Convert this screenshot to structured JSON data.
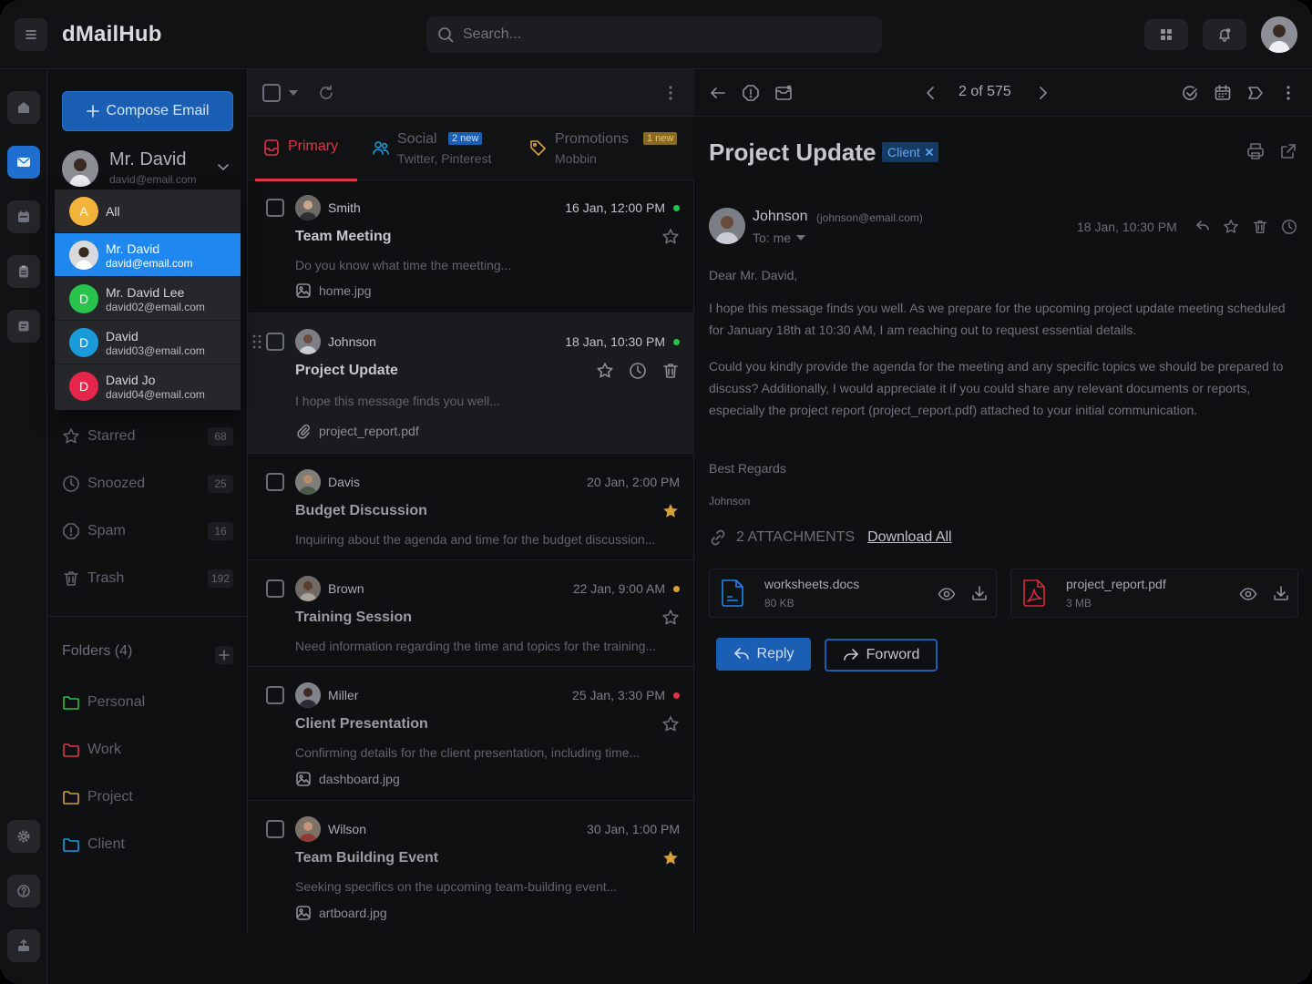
{
  "app": {
    "title": "dMailHub"
  },
  "search": {
    "placeholder": "Search..."
  },
  "compose": {
    "label": "Compose Email"
  },
  "account": {
    "name": "Mr. David",
    "email": "david@email.com"
  },
  "account_menu": [
    {
      "initial": "A",
      "name": "All",
      "email": "",
      "color": "#f4b33a"
    },
    {
      "initial": "",
      "name": "Mr. David",
      "email": "david@email.com",
      "color": "#8a8e96",
      "selected": true
    },
    {
      "initial": "D",
      "name": "Mr. David Lee",
      "email": "david02@email.com",
      "color": "#29c24a"
    },
    {
      "initial": "D",
      "name": "David",
      "email": "david03@email.com",
      "color": "#1a9bd9"
    },
    {
      "initial": "D",
      "name": "David Jo",
      "email": "david04@email.com",
      "color": "#e5254a"
    }
  ],
  "nav": [
    {
      "label": "Starred",
      "count": "68",
      "icon": "star-icon"
    },
    {
      "label": "Snoozed",
      "count": "25",
      "icon": "clock-icon"
    },
    {
      "label": "Spam",
      "count": "16",
      "icon": "spam-icon"
    },
    {
      "label": "Trash",
      "count": "192",
      "icon": "trash-icon"
    }
  ],
  "folders": {
    "header": "Folders (4)",
    "items": [
      {
        "label": "Personal",
        "color": "#29c24a"
      },
      {
        "label": "Work",
        "color": "#e0334a"
      },
      {
        "label": "Project",
        "color": "#d6a038"
      },
      {
        "label": "Client",
        "color": "#1a9bd9"
      }
    ]
  },
  "tabs": [
    {
      "label": "Primary",
      "sub": "",
      "badge": ""
    },
    {
      "label": "Social",
      "sub": "Twitter, Pinterest",
      "badge": "2 new"
    },
    {
      "label": "Promotions",
      "sub": "Mobbin",
      "badge": "1 new"
    }
  ],
  "mails": [
    {
      "sender": "Smith",
      "date": "16 Jan, 12:00 PM",
      "dot": "#29c24a",
      "subject": "Team Meeting",
      "preview": "Do you know what time the meetting...",
      "attachment": "home.jpg",
      "att_icon": "image-icon",
      "starred": false
    },
    {
      "sender": "Johnson",
      "date": "18 Jan, 10:30 PM",
      "dot": "#29c24a",
      "subject": "Project Update",
      "preview": "I hope this message finds you well...",
      "attachment": "project_report.pdf",
      "att_icon": "paperclip-icon",
      "starred": false
    },
    {
      "sender": "Davis",
      "date": "20 Jan, 2:00 PM",
      "dot": "",
      "subject": "Budget Discussion",
      "preview": "Inquiring about the agenda and time for the budget discussion...",
      "attachment": "",
      "att_icon": "",
      "starred": true
    },
    {
      "sender": "Brown",
      "date": "22 Jan, 9:00 AM",
      "dot": "#d6a038",
      "subject": "Training Session",
      "preview": "Need information regarding the time and topics for the training...",
      "attachment": "",
      "att_icon": "",
      "starred": false
    },
    {
      "sender": "Miller",
      "date": "25 Jan, 3:30 PM",
      "dot": "#e0334a",
      "subject": "Client Presentation",
      "preview": "Confirming details for the client presentation, including time...",
      "attachment": "dashboard.jpg",
      "att_icon": "image-icon",
      "starred": false
    },
    {
      "sender": "Wilson",
      "date": "30 Jan, 1:00 PM",
      "dot": "",
      "subject": "Team Building Event",
      "preview": "Seeking specifics on the upcoming team-building event...",
      "attachment": "artboard.jpg",
      "att_icon": "image-icon",
      "starred": true
    }
  ],
  "reader": {
    "pager": "2 of 575",
    "title": "Project Update",
    "tag": "Client",
    "from_name": "Johnson",
    "from_email": "(johnson@email.com)",
    "to": "To: me",
    "date": "18 Jan, 10:30 PM",
    "greeting": "Dear Mr. David,",
    "p1": "I hope this message finds you well. As we prepare for the upcoming project update meeting scheduled for January 18th at 10:30 AM, I am reaching out to request essential details.",
    "p2": "Could you kindly provide the agenda for the meeting and any specific topics we should be prepared to discuss? Additionally, I would appreciate it if you could share any relevant documents or reports, especially the project report (project_report.pdf) attached to your initial communication.",
    "closing": "Best Regards",
    "signature": "Johnson",
    "attachments_label": "2 ATTACHMENTS",
    "download_all": "Download All",
    "files": [
      {
        "name": "worksheets.docs",
        "size": "80 KB",
        "icon": "doc-icon"
      },
      {
        "name": "project_report.pdf",
        "size": "3 MB",
        "icon": "pdf-icon"
      }
    ],
    "reply": "Reply",
    "forward": "Forword"
  }
}
